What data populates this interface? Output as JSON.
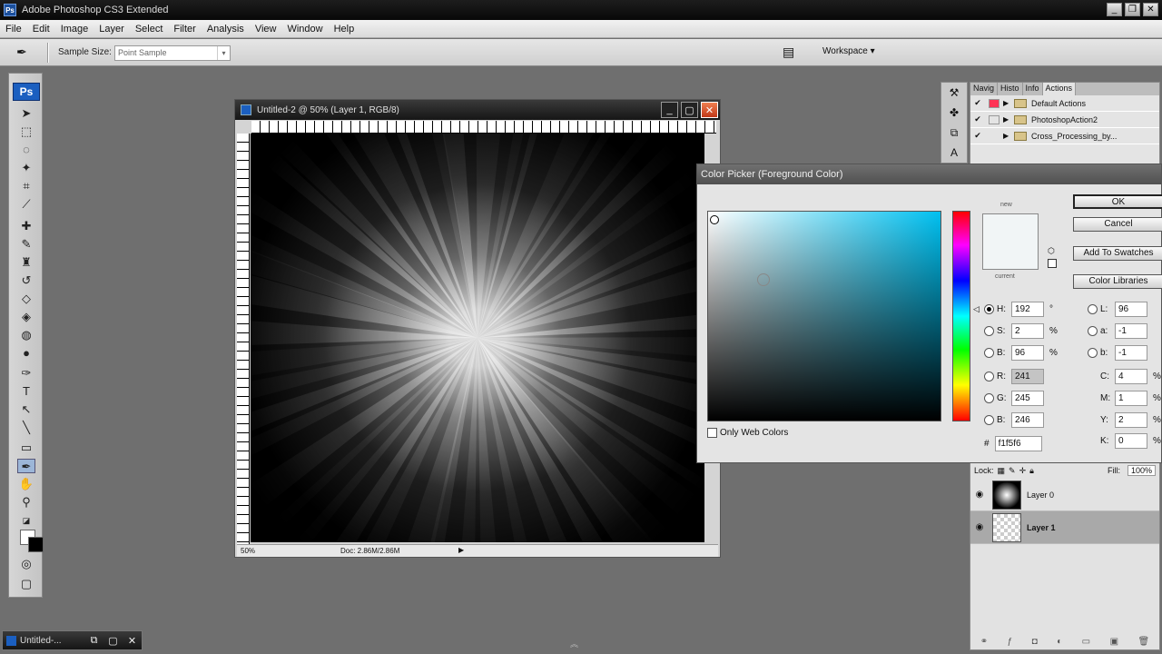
{
  "window": {
    "title": "Adobe Photoshop CS3 Extended"
  },
  "menu": [
    "File",
    "Edit",
    "Image",
    "Layer",
    "Select",
    "Filter",
    "Analysis",
    "View",
    "Window",
    "Help"
  ],
  "options": {
    "sample_size_label": "Sample Size:",
    "sample_size_value": "Point Sample",
    "workspace_label": "Workspace ▾"
  },
  "tools": {
    "logo": "Ps"
  },
  "document": {
    "title": "Untitled-2 @ 50% (Layer 1, RGB/8)",
    "zoom": "50%",
    "doc_size": "Doc: 2.86M/2.86M"
  },
  "actions_panel": {
    "tabs": [
      "Navig",
      "Histo",
      "Info",
      "Actions"
    ],
    "rows": [
      "Default Actions",
      "PhotoshopAction2",
      "Cross_Processing_by..."
    ]
  },
  "layers_panel": {
    "lock_label": "Lock:",
    "fill_label": "Fill:",
    "fill_value": "100%",
    "layers": [
      {
        "name": "Layer 0"
      },
      {
        "name": "Layer 1"
      }
    ]
  },
  "color_picker": {
    "title": "Color Picker (Foreground Color)",
    "new_label": "new",
    "current_label": "current",
    "ok": "OK",
    "cancel": "Cancel",
    "add_swatches": "Add To Swatches",
    "color_libraries": "Color Libraries",
    "only_web_colors": "Only Web Colors",
    "H": "192",
    "S": "2",
    "B": "96",
    "R": "241",
    "G": "245",
    "Bl": "246",
    "L": "96",
    "a": "-1",
    "b": "-1",
    "C": "4",
    "M": "1",
    "Y": "2",
    "K": "0",
    "hex": "f1f5f6",
    "deg": "°",
    "pct": "%",
    "hash": "#"
  },
  "minimized_doc": {
    "title": "Untitled-..."
  },
  "colors": {
    "picked": "#f1f5f6",
    "hue_cyan": "#00c0f0"
  }
}
